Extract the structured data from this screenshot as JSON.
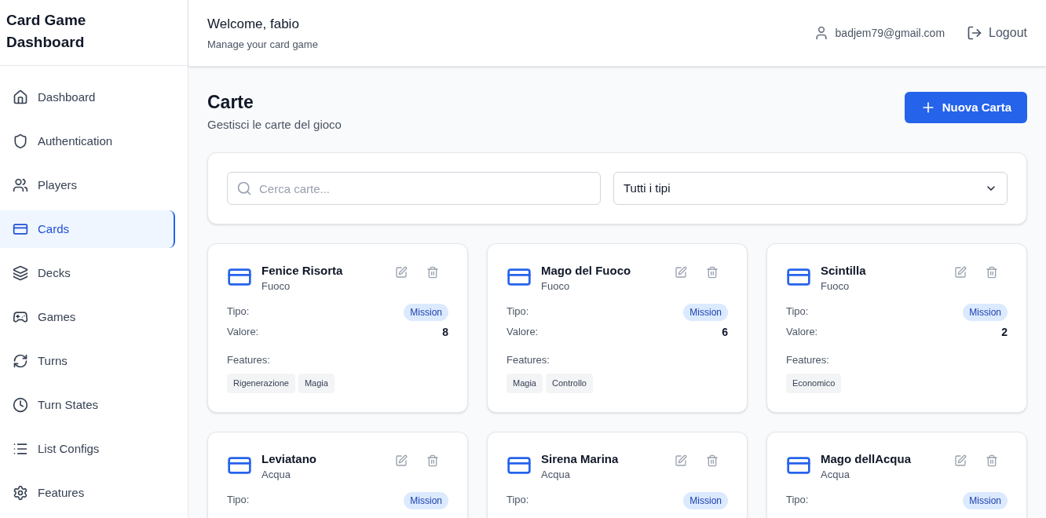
{
  "sidebar": {
    "title": "Card Game Dashboard",
    "items": [
      {
        "label": "Dashboard",
        "selected": false
      },
      {
        "label": "Authentication",
        "selected": false
      },
      {
        "label": "Players",
        "selected": false
      },
      {
        "label": "Cards",
        "selected": true
      },
      {
        "label": "Decks",
        "selected": false
      },
      {
        "label": "Games",
        "selected": false
      },
      {
        "label": "Turns",
        "selected": false
      },
      {
        "label": "Turn States",
        "selected": false
      },
      {
        "label": "List Configs",
        "selected": false
      },
      {
        "label": "Features",
        "selected": false
      }
    ]
  },
  "header": {
    "welcome": "Welcome, fabio",
    "subtitle": "Manage your card game",
    "email": "badjem79@gmail.com",
    "logout": "Logout"
  },
  "page": {
    "title": "Carte",
    "subtitle": "Gestisci le carte del gioco",
    "new_button": "Nuova Carta"
  },
  "filters": {
    "search_placeholder": "Cerca carte...",
    "type_select": "Tutti i tipi"
  },
  "cards": [
    {
      "name": "Fenice Risorta",
      "element": "Fuoco",
      "type_label": "Tipo:",
      "type": "Mission",
      "value_label": "Valore:",
      "value": "8",
      "features_label": "Features:",
      "features": [
        "Rigenerazione",
        "Magia"
      ]
    },
    {
      "name": "Mago del Fuoco",
      "element": "Fuoco",
      "type_label": "Tipo:",
      "type": "Mission",
      "value_label": "Valore:",
      "value": "6",
      "features_label": "Features:",
      "features": [
        "Magia",
        "Controllo"
      ]
    },
    {
      "name": "Scintilla",
      "element": "Fuoco",
      "type_label": "Tipo:",
      "type": "Mission",
      "value_label": "Valore:",
      "value": "2",
      "features_label": "Features:",
      "features": [
        "Economico"
      ]
    },
    {
      "name": "Leviatano",
      "element": "Acqua",
      "type_label": "Tipo:",
      "type": "Mission"
    },
    {
      "name": "Sirena Marina",
      "element": "Acqua",
      "type_label": "Tipo:",
      "type": "Mission"
    },
    {
      "name": "Mago dellAcqua",
      "element": "Acqua",
      "type_label": "Tipo:",
      "type": "Mission"
    }
  ]
}
